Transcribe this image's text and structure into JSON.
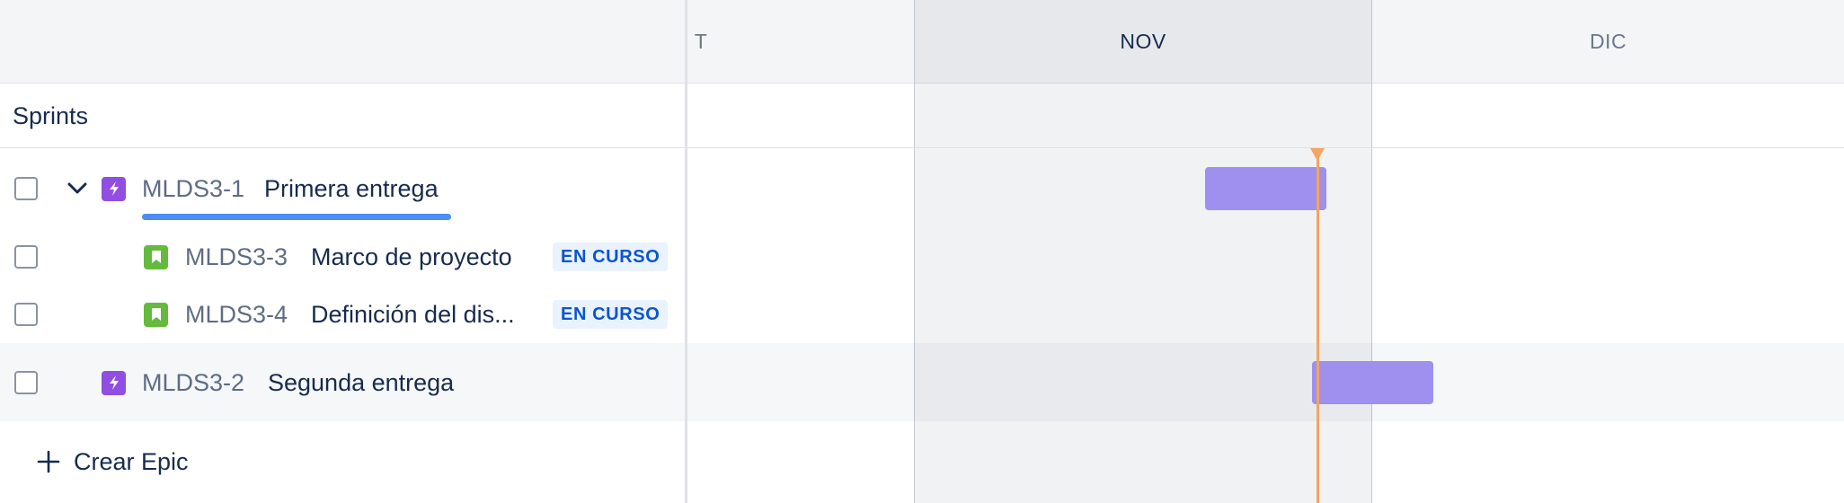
{
  "timeline": {
    "months": [
      {
        "label": "T"
      },
      {
        "label": "NOV"
      },
      {
        "label": "DIC"
      }
    ]
  },
  "sprints": {
    "label": "Sprints"
  },
  "epics": [
    {
      "key": "MLDS3-1",
      "summary": "Primera entrega",
      "expanded": true,
      "children": [
        {
          "key": "MLDS3-3",
          "summary": "Marco de proyecto",
          "status": "EN CURSO"
        },
        {
          "key": "MLDS3-4",
          "summary": "Definición del dis...",
          "status": "EN CURSO"
        }
      ]
    },
    {
      "key": "MLDS3-2",
      "summary": "Segunda entrega",
      "expanded": false,
      "children": []
    }
  ],
  "create_epic": {
    "label": "Crear Epic"
  },
  "colors": {
    "bar": "#9f8fef",
    "today_marker": "#f5a462",
    "epic_icon": "#904ee2",
    "story_icon": "#63ba3c",
    "progress": "#4c8cf5",
    "lozenge_bg": "#e9f2ff",
    "lozenge_text": "#0c55cc"
  }
}
